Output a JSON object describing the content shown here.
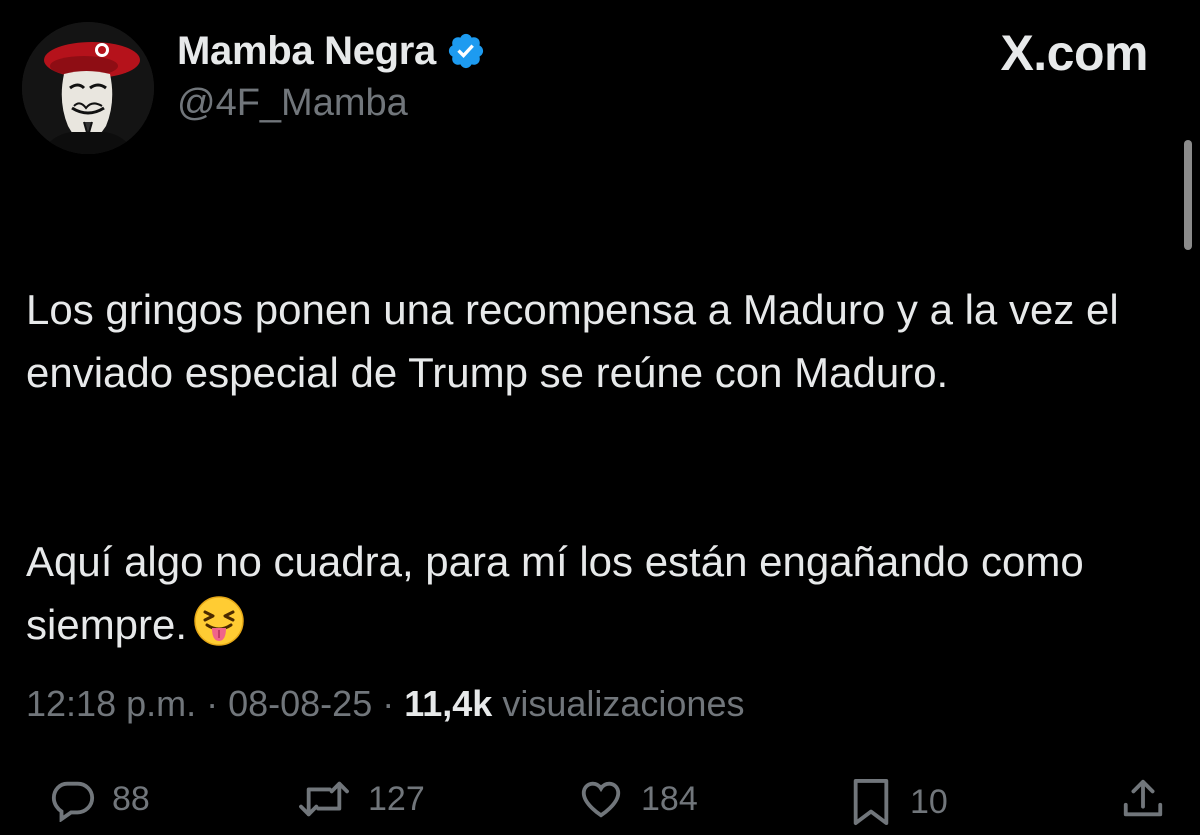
{
  "author": {
    "display_name": "Mamba Negra",
    "handle": "@4F_Mamba",
    "verified": true,
    "avatar_icon": "anonymous-mask-red-beret-avatar"
  },
  "watermark": "X.com",
  "tweet": {
    "paragraphs": [
      "Los gringos ponen una recompensa a Maduro y a la vez el enviado especial de Trump se reúne con Maduro.",
      "Aquí algo no cuadra, para mí los están engañando como siempre."
    ],
    "emoji": "squinting-face-with-tongue"
  },
  "meta": {
    "time": "12:18 p.m.",
    "separator": "·",
    "date": "08-08-25",
    "views_count": "11,4k",
    "views_label": "visualizaciones"
  },
  "actions": {
    "replies": "88",
    "reposts": "127",
    "likes": "184",
    "bookmarks": "10"
  },
  "colors": {
    "background": "#000000",
    "primary_text": "#e7e9ea",
    "secondary_text": "#71767b",
    "verified_blue": "#1d9bf0",
    "beret_red": "#b5121b"
  }
}
